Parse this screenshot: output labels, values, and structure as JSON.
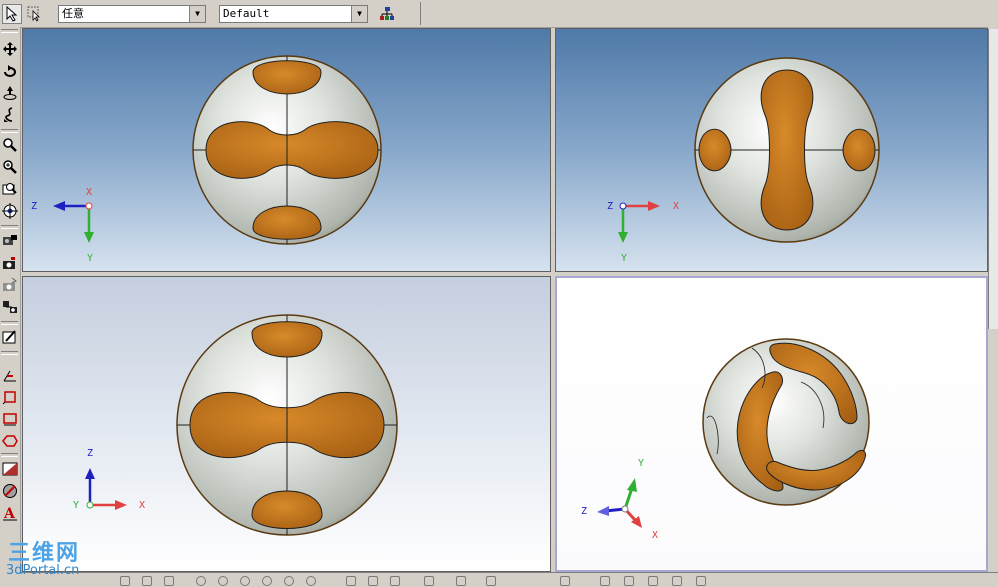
{
  "toolbar": {
    "filter_select": {
      "value": "任意"
    },
    "view_select": {
      "value": "Default"
    },
    "icons": [
      "arrow-select-icon",
      "pointer-select-icon",
      "tree-hierarchy-icon"
    ]
  },
  "left_toolbar": {
    "icons": [
      "pan-icon",
      "rotate-icon",
      "fly-icon",
      "spin-icon",
      "zoom-icon",
      "zoom-window-icon",
      "zoom-fit-icon",
      "target-icon",
      "camera-icon",
      "camera-2-icon",
      "camera-3-icon",
      "camera-4-icon",
      "sketch-icon",
      "dimension-icon",
      "box-icon",
      "frame-icon",
      "section-icon",
      "slice-icon",
      "no-icon",
      "text-icon"
    ]
  },
  "viewports": {
    "top_left": {
      "axis_labels": {
        "horizontal": "Z",
        "vertical": "Y",
        "depth": "X"
      }
    },
    "top_right": {
      "axis_labels": {
        "left": "Z",
        "right": "X",
        "vertical": "Y"
      }
    },
    "bottom_left": {
      "axis_labels": {
        "vertical": "Z",
        "left": "Y",
        "right": "X"
      }
    },
    "bottom_right": {
      "axis_labels": {
        "up": "Y",
        "left": "Z",
        "down": "X"
      }
    }
  },
  "colors": {
    "sphere_silver": "#d8dcd6",
    "patch_orange": "#c87d1e",
    "axis_red": "#e04040",
    "axis_green": "#30b030",
    "axis_blue": "#2020c0",
    "viewport_border_active": "#a7a7d4"
  },
  "watermark": {
    "title": "三维网",
    "site": "3dPortal.cn"
  }
}
